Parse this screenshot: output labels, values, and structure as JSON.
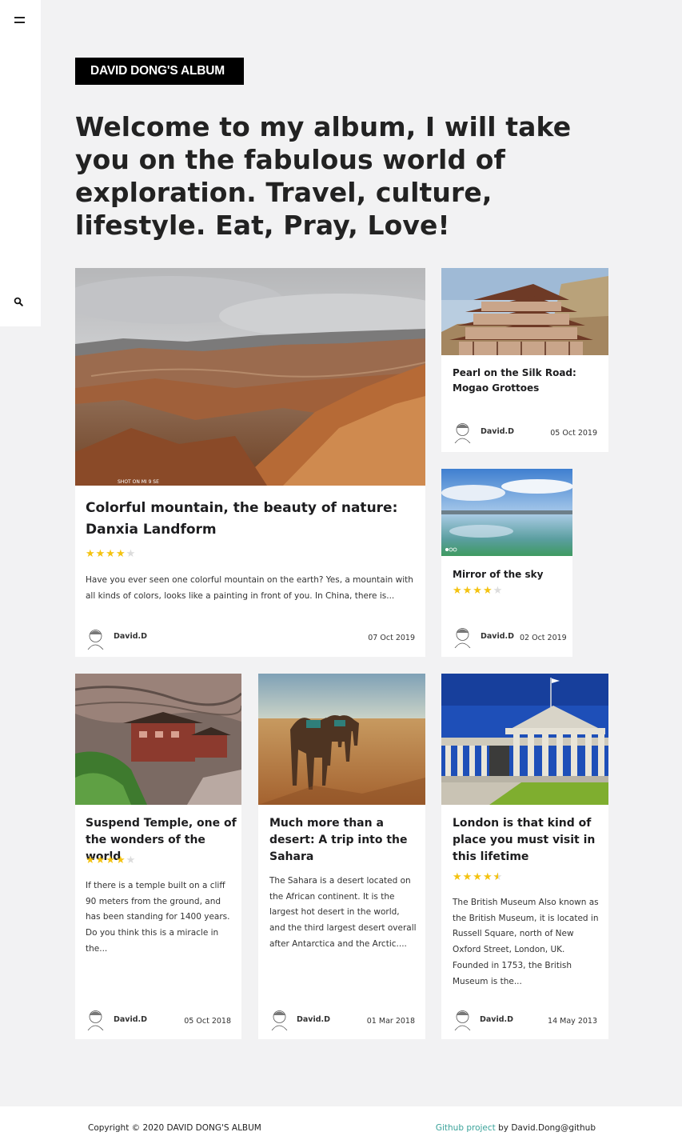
{
  "sidebar": {
    "menu_icon": "hamburger-icon",
    "search_icon": "search-icon"
  },
  "brand": "DAVID DONG'S ALBUM",
  "headline": "Welcome to my album, I will take you on the fabulous world of exploration. Travel, culture, lifestyle. Eat, Pray, Love!",
  "featured": {
    "photo_caption": "SHOT ON MI 9 SE",
    "title": "Colorful mountain, the beauty of nature: Danxia Landform",
    "rating": 4,
    "excerpt": "Have you ever seen one colorful mountain on the earth? Yes, a mountain with all kinds of colors, looks like a painting in front of you. In China, there is...",
    "author": "David.D",
    "date": "07 Oct 2019"
  },
  "mogao": {
    "title": "Pearl on the Silk Road: Mogao Grottoes",
    "author": "David.D",
    "date": "05 Oct 2019"
  },
  "mirror": {
    "title": "Mirror of the sky",
    "rating": 4,
    "author": "David.D",
    "date": "02 Oct 2019"
  },
  "suspend": {
    "title": "Suspend Temple, one of the wonders of the world",
    "rating": 4,
    "excerpt": "If there is a temple built on a cliff 90 meters from the ground, and has been standing for 1400 years. Do you think this is a miracle in the...",
    "author": "David.D",
    "date": "05 Oct 2018"
  },
  "sahara": {
    "title": "Much more than a desert: A trip into the Sahara",
    "excerpt": "The Sahara is a desert located on the African continent. It is the largest hot desert in the world, and the third largest desert overall after Antarctica and the Arctic....",
    "author": "David.D",
    "date": "01 Mar 2018"
  },
  "london": {
    "title": "London is that kind of place you must visit in this lifetime",
    "rating": 4.5,
    "excerpt": "The British Museum Also known as the British Museum, it is located in Russell Square, north of New Oxford Street, London, UK. Founded in 1753, the British Museum is the...",
    "author": "David.D",
    "date": "14 May 2013"
  },
  "footer": {
    "copyright": "Copyright © 2020 DAVID DONG'S ALBUM",
    "github_link": "Github project",
    "github_suffix": " by David.Dong@github"
  },
  "colors": {
    "accent_link": "#3aa39a",
    "star": "#f4c311",
    "brand_bg": "#000000"
  }
}
